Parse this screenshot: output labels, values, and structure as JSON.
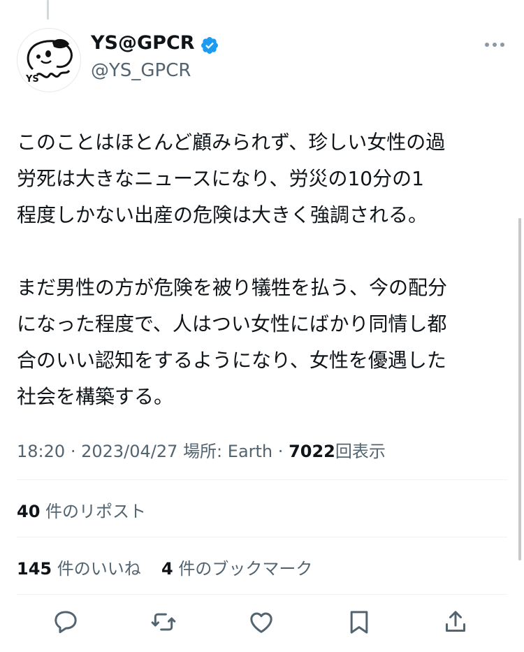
{
  "author": {
    "display_name": "YS@GPCR",
    "handle": "@YS_GPCR",
    "avatar_text": "YS"
  },
  "tweet": {
    "paragraph1": "このことはほとんど顧みられず、珍しい女性の過労死は大きなニュースになり、労災の10分の1程度しかない出産の危険は大きく強調される。",
    "paragraph1_lines": [
      "このことはほとんど顧みられず、珍しい女性の過",
      "労死は大きなニュースになり、労災の10分の1",
      "程度しかない出産の危険は大きく強調される。"
    ],
    "paragraph2": "まだ男性の方が危険を被り犠牲を払う、今の配分になった程度で、人はつい女性にばかり同情し都合のいい認知をするようになり、女性を優遇した社会を構築する。",
    "paragraph2_lines": [
      "まだ男性の方が危険を被り犠牲を払う、今の配分",
      "になった程度で、人はつい女性にばかり同情し都",
      "合のいい認知をするようになり、女性を優遇した",
      "社会を構築する。"
    ]
  },
  "meta": {
    "time": "18:20",
    "date": "2023/04/27",
    "location": "場所: Earth",
    "separator": "·",
    "views_count": "7022",
    "views_label": "回表示"
  },
  "stats": {
    "reposts_count": "40",
    "reposts_label": "件のリポスト",
    "likes_count": "145",
    "likes_label": "件のいいね",
    "bookmarks_count": "4",
    "bookmarks_label": "件のブックマーク"
  },
  "icons": {
    "verified": "verified-badge-icon",
    "more": "more-dots-icon",
    "reply": "reply-icon",
    "retweet": "retweet-icon",
    "like": "heart-icon",
    "bookmark": "bookmark-icon",
    "share": "share-icon"
  },
  "colors": {
    "verified_blue": "#1d9bf0",
    "secondary_text": "#536471",
    "primary_text": "#0f1419"
  }
}
